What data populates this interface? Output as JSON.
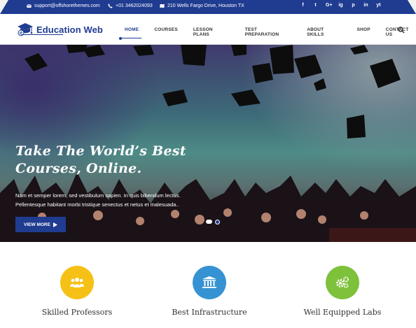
{
  "topbar": {
    "email": "support@offshorethemes.com",
    "phone": "+01 3462024093",
    "address": "210 Wells Fargo Drive, Houston TX",
    "social": [
      "f",
      "t",
      "G+",
      "ig",
      "p",
      "in",
      "yt"
    ]
  },
  "brand": {
    "name": "Education Web"
  },
  "nav": {
    "items": [
      "HOME",
      "COURSES",
      "LESSON PLANS",
      "TEST PREPARATION",
      "ABOUT SKILLS",
      "SHOP",
      "CONTACT US"
    ]
  },
  "hero": {
    "title_line1": "Take The World’s Best",
    "title_line2": "Courses, Online.",
    "text_line1": "Nam et semper lorem, sed vestibulum sapien. In quis bibendum lectus.",
    "text_line2": "Pellentesque habitant morbi tristique senectus et netus et malesuada..",
    "button": "VIEW MORE"
  },
  "features": [
    {
      "title": "Skilled Professors",
      "color": "#f6c116",
      "icon": "users-icon"
    },
    {
      "title": "Best Infrastructure",
      "color": "#3593d3",
      "icon": "bank-icon"
    },
    {
      "title": "Well Equipped Labs",
      "color": "#7ec13b",
      "icon": "gears-icon"
    }
  ],
  "colors": {
    "brand": "#1f3c91"
  }
}
